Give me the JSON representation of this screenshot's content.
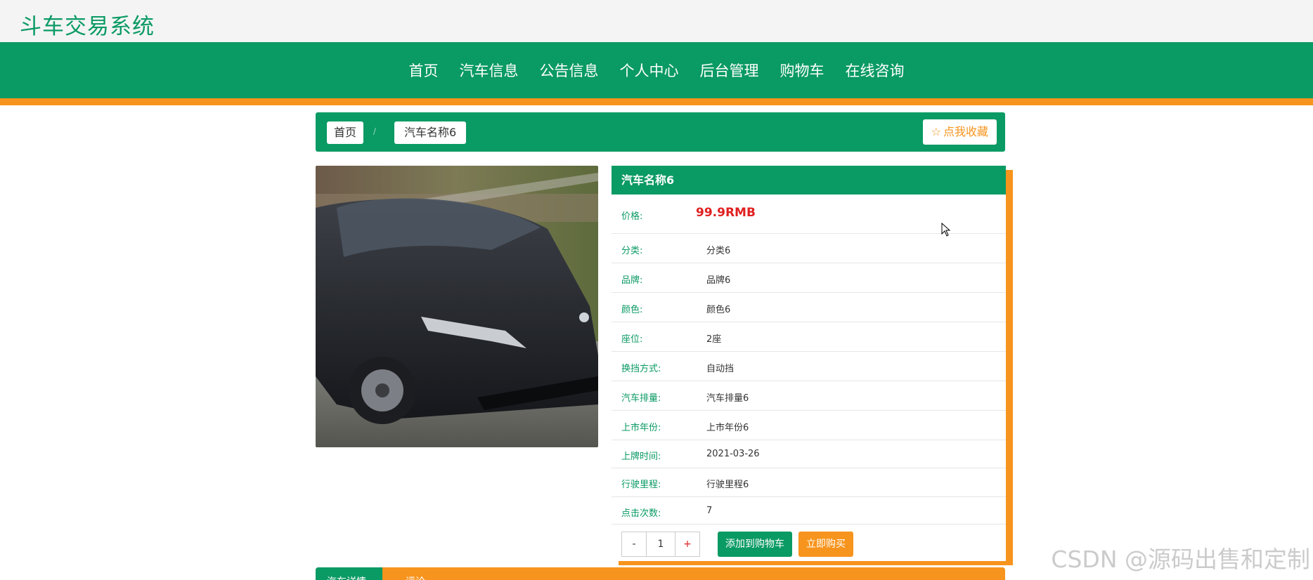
{
  "site": {
    "title": "斗车交易系统"
  },
  "nav": [
    {
      "label": "首页"
    },
    {
      "label": "汽车信息"
    },
    {
      "label": "公告信息"
    },
    {
      "label": "个人中心"
    },
    {
      "label": "后台管理"
    },
    {
      "label": "购物车"
    },
    {
      "label": "在线咨询"
    }
  ],
  "breadcrumb": {
    "home": "首页",
    "separator": "/",
    "current": "汽车名称6"
  },
  "favorite": {
    "icon": "star-outline-icon",
    "label": "点我收藏"
  },
  "car_image": {
    "icon": "car-photo"
  },
  "detail": {
    "name": "汽车名称6",
    "price_label": "价格:",
    "price": "99.9RMB",
    "rows": [
      {
        "label": "分类:",
        "value": "分类6"
      },
      {
        "label": "品牌:",
        "value": "品牌6"
      },
      {
        "label": "颜色:",
        "value": "颜色6"
      },
      {
        "label": "座位:",
        "value": "2座"
      },
      {
        "label": "换挡方式:",
        "value": "自动挡"
      },
      {
        "label": "汽车排量:",
        "value": "汽车排量6"
      },
      {
        "label": "上市年份:",
        "value": "上市年份6"
      },
      {
        "label": "上牌时间:",
        "value": "2021-03-26"
      },
      {
        "label": "行驶里程:",
        "value": "行驶里程6"
      },
      {
        "label": "点击次数:",
        "value": "7"
      }
    ]
  },
  "quantity": {
    "minus": "-",
    "value": "1",
    "plus": "+"
  },
  "actions": {
    "add_to_cart": "添加到购物车",
    "buy_now": "立即购买"
  },
  "tabs": [
    {
      "label": "汽车详情"
    },
    {
      "label": "评论"
    }
  ],
  "watermark": "CSDN @源码出售和定制",
  "colors": {
    "primary": "#0a9a64",
    "accent": "#f7941d",
    "price": "#e02020"
  }
}
